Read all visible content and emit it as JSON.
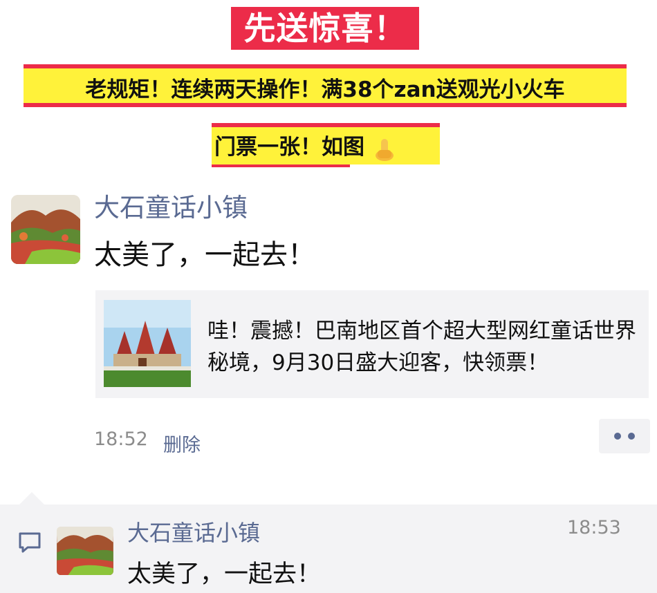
{
  "promo": {
    "headline": "先送惊喜！",
    "rule_text": "老规矩！连续两天操作！满38个zan送观光小火车",
    "ticket_text": "门票一张！如图"
  },
  "post": {
    "author": "大石童话小镇",
    "text": "太美了，一起去！",
    "share_card": {
      "text": "哇！震撼！巴南地区首个超大型网红童话世界秘境，9月30日盛大迎客，快领票！"
    },
    "time": "18:52",
    "delete_label": "删除"
  },
  "comment": {
    "author": "大石童话小镇",
    "time": "18:53",
    "text": "太美了，一起去！"
  },
  "colors": {
    "banner_red": "#ec2c49",
    "banner_yellow": "#fff23a",
    "name_blue": "#5a6a92"
  },
  "icons": {
    "banner_emoji": "thumbs-up-icon",
    "more": "more-dots-icon",
    "comment": "comment-icon"
  }
}
